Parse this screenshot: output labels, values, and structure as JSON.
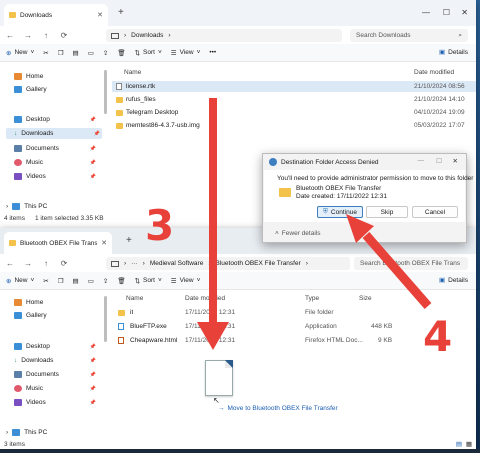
{
  "win1": {
    "tab_title": "Downloads",
    "path": [
      "Downloads"
    ],
    "search_placeholder": "Search Downloads",
    "toolbar": {
      "new": "New",
      "sort": "Sort",
      "view": "View",
      "more": "•••",
      "details": "Details"
    },
    "sidebar": [
      "Home",
      "Gallery",
      "Desktop",
      "Downloads",
      "Documents",
      "Music",
      "Videos",
      "This PC"
    ],
    "columns": {
      "name": "Name",
      "date": "Date modified"
    },
    "rows": [
      {
        "name": "license.rtk",
        "date": "21/10/2024 08:56"
      },
      {
        "name": "rufus_files",
        "date": "21/10/2024 14:10"
      },
      {
        "name": "Telegram Desktop",
        "date": "04/10/2024 19:09"
      },
      {
        "name": "memtest86-4.3.7-usb.img",
        "date": "05/03/2022 17:07"
      }
    ],
    "status": {
      "items": "4 items",
      "selected": "1 item selected  3.35 KB"
    }
  },
  "win2": {
    "tab_title": "Bluetooth OBEX File Transfer",
    "path": [
      "Medieval Software",
      "Bluetooth OBEX File Transfer"
    ],
    "search_placeholder": "Search Bluetooth OBEX File Trans",
    "toolbar": {
      "new": "New",
      "sort": "Sort",
      "view": "View",
      "more": "•••",
      "details": "Details"
    },
    "sidebar": [
      "Home",
      "Gallery",
      "Desktop",
      "Downloads",
      "Documents",
      "Music",
      "Videos",
      "This PC"
    ],
    "columns": {
      "name": "Name",
      "date": "Date modified",
      "type": "Type",
      "size": "Size"
    },
    "rows": [
      {
        "name": "it",
        "date": "17/11/2022 12:31",
        "type": "File folder",
        "size": ""
      },
      {
        "name": "BlueFTP.exe",
        "date": "17/11/2022 12:31",
        "type": "Application",
        "size": "448 KB"
      },
      {
        "name": "Cheapware.html",
        "date": "17/11/2022 12:31",
        "type": "Firefox HTML Doc...",
        "size": "9 KB"
      }
    ],
    "status": {
      "items": "3 items"
    }
  },
  "dialog": {
    "title": "Destination Folder Access Denied",
    "message": "You'll need to provide administrator permission to move to this folder",
    "folder_name": "Bluetooth OBEX File Transfer",
    "folder_date": "Date created: 17/11/2022 12:31",
    "continue": "Continue",
    "skip": "Skip",
    "cancel": "Cancel",
    "fewer_details": "Fewer details"
  },
  "annotations": {
    "step3": "3",
    "step4": "4",
    "arrow_color": "#e8413a"
  },
  "drag_tooltip": "Move to Bluetooth OBEX File Transfer"
}
